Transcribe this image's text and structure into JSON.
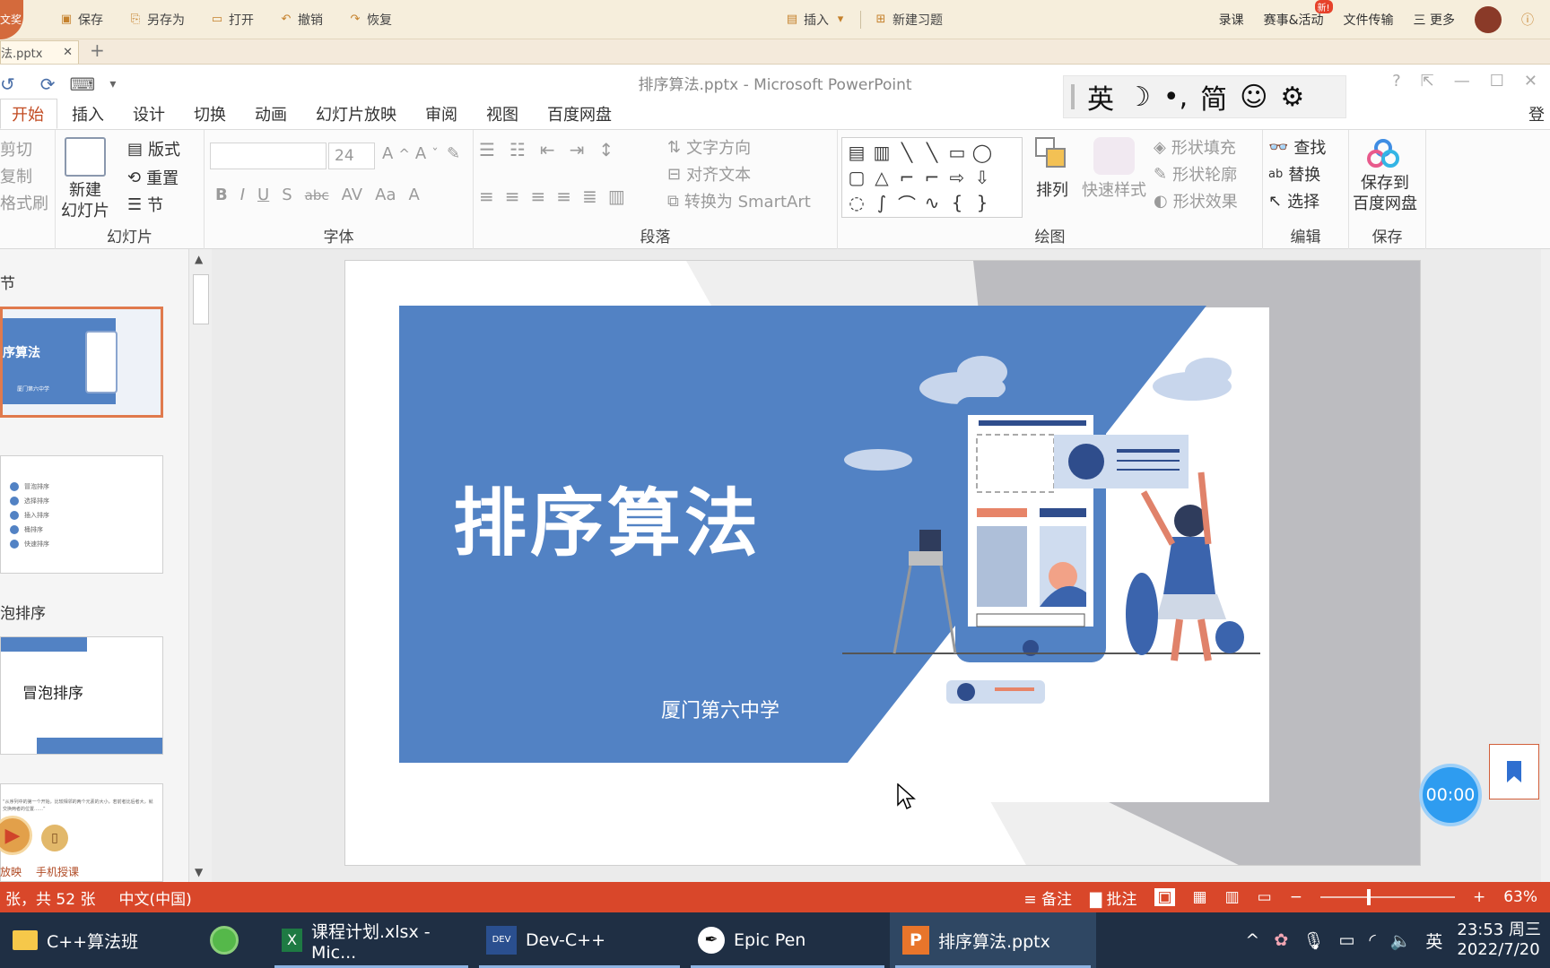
{
  "topbar": {
    "brand": "文奖",
    "save": "保存",
    "save_as": "另存为",
    "open": "打开",
    "undo": "撤销",
    "redo": "恢复",
    "insert": "插入",
    "new_exercise": "新建习题",
    "record": "录课",
    "events": "赛事&活动",
    "new_badge": "新!",
    "file_transfer": "文件传输",
    "more": "三 更多"
  },
  "doc_tab": {
    "name": "法.pptx"
  },
  "window": {
    "title": "排序算法.pptx - Microsoft PowerPoint",
    "login": "登"
  },
  "ime": {
    "lang": "英",
    "moon": "☽",
    "punct": "•,",
    "simp": "简",
    "emoji": "☺",
    "gear": "⚙"
  },
  "ribbon_tabs": [
    "开始",
    "插入",
    "设计",
    "切换",
    "动画",
    "幻灯片放映",
    "审阅",
    "视图",
    "百度网盘"
  ],
  "ribbon": {
    "clipboard": {
      "cut": "剪切",
      "copy": "复制",
      "format_painter": "格式刷"
    },
    "slides": {
      "new_slide_1": "新建",
      "new_slide_2": "幻灯片",
      "layout": "版式",
      "reset": "重置",
      "section": "节",
      "label": "幻灯片"
    },
    "font": {
      "size": "24",
      "bold": "B",
      "italic": "I",
      "underline": "U",
      "shadow": "S",
      "strike": "abc",
      "spacing": "AV",
      "case": "Aa",
      "color": "A",
      "label": "字体"
    },
    "paragraph": {
      "text_dir": "文字方向",
      "align_text": "对齐文本",
      "smartart": "转换为 SmartArt",
      "label": "段落"
    },
    "drawing": {
      "arrange": "排列",
      "quick_styles": "快速样式",
      "fill": "形状填充",
      "outline": "形状轮廓",
      "effects": "形状效果",
      "label": "绘图"
    },
    "editing": {
      "find": "查找",
      "replace": "替换",
      "select": "选择",
      "label": "编辑"
    },
    "save": {
      "save_to_1": "保存到",
      "save_to_2": "百度网盘",
      "label": "保存"
    }
  },
  "slides_panel": {
    "section1": "节",
    "thumb1_title": "序算法",
    "thumb1_sub": "厦门第六中学",
    "toc": [
      "冒泡排序",
      "选择排序",
      "插入排序",
      "桶排序",
      "快速排序"
    ],
    "section2": "泡排序",
    "thumb3_title": "冒泡排序",
    "thumb4_text": "“从序列中的第一个开始，比较相邻的两个元素的大小，若前者比后者大，就交换两者的位置……”",
    "play_label": "放映",
    "phone_label": "手机授课"
  },
  "slide": {
    "title": "排序算法",
    "subtitle": "厦门第六中学"
  },
  "timer": "00:00",
  "statusbar": {
    "page": "张，共 52 张",
    "lang": "中文(中国)",
    "notes": "备注",
    "comments": "批注",
    "zoom": "63%"
  },
  "taskbar": {
    "folder": "C++算法班",
    "excel": "课程计划.xlsx - Mic...",
    "devcpp": "Dev-C++",
    "epicpen": "Epic Pen",
    "ppt": "排序算法.pptx",
    "ime": "英",
    "time": "23:53 周三",
    "date": "2022/7/20"
  },
  "colors": {
    "accent": "#d9472a",
    "slide_blue": "#5282c4",
    "taskbar": "#1f2f44"
  }
}
